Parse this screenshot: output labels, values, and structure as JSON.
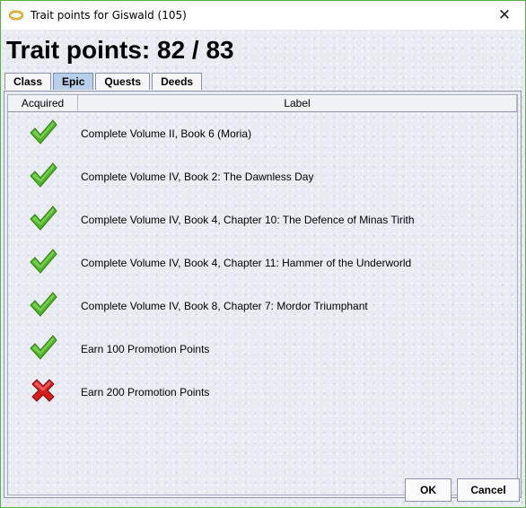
{
  "window": {
    "title": "Trait points for Giswald (105)",
    "close_glyph": "✕"
  },
  "heading": "Trait points: 82 / 83",
  "tabs": [
    {
      "label": "Class",
      "active": false
    },
    {
      "label": "Epic",
      "active": true
    },
    {
      "label": "Quests",
      "active": false
    },
    {
      "label": "Deeds",
      "active": false
    }
  ],
  "table": {
    "columns": [
      "Acquired",
      "Label"
    ],
    "rows": [
      {
        "acquired": true,
        "icon": "check-icon",
        "label": "Complete Volume II, Book 6 (Moria)"
      },
      {
        "acquired": true,
        "icon": "check-icon",
        "label": "Complete Volume IV, Book 2: The Dawnless Day"
      },
      {
        "acquired": true,
        "icon": "check-icon",
        "label": "Complete Volume IV, Book 4, Chapter 10: The Defence of Minas Tirith"
      },
      {
        "acquired": true,
        "icon": "check-icon",
        "label": "Complete Volume IV, Book 4, Chapter 11: Hammer of the Underworld"
      },
      {
        "acquired": true,
        "icon": "check-icon",
        "label": "Complete Volume IV, Book 8, Chapter 7: Mordor Triumphant"
      },
      {
        "acquired": true,
        "icon": "check-icon",
        "label": "Earn 100 Promotion Points"
      },
      {
        "acquired": false,
        "icon": "cross-icon",
        "label": "Earn 200 Promotion Points"
      }
    ]
  },
  "buttons": {
    "ok": "OK",
    "cancel": "Cancel"
  },
  "colors": {
    "check": "#4fb527",
    "cross": "#d11f1f",
    "tab_active": "#b8cfe9",
    "window_border": "#5bb04a"
  }
}
